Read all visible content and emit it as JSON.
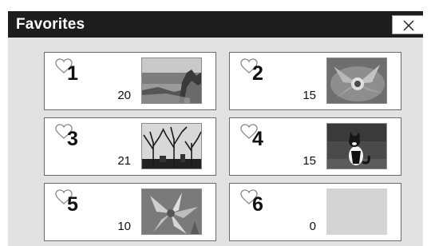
{
  "window": {
    "title": "Favorites",
    "close_label": "×"
  },
  "favorites": [
    {
      "number": "1",
      "count": "20",
      "thumbnail": "coastal-cliff-photo",
      "selected": true
    },
    {
      "number": "2",
      "count": "15",
      "thumbnail": "flower-closeup-photo",
      "selected": false
    },
    {
      "number": "3",
      "count": "21",
      "thumbnail": "bare-trees-photo",
      "selected": false
    },
    {
      "number": "4",
      "count": "15",
      "thumbnail": "cat-photo",
      "selected": false
    },
    {
      "number": "5",
      "count": "10",
      "thumbnail": "lily-flower-photo",
      "selected": false
    },
    {
      "number": "6",
      "count": "0",
      "thumbnail": "empty-thumbnail",
      "selected": false
    }
  ],
  "colors": {
    "titlebar": "#1d1d1d",
    "panel": "#e2e2e2",
    "selection": "#1e4d7b"
  }
}
